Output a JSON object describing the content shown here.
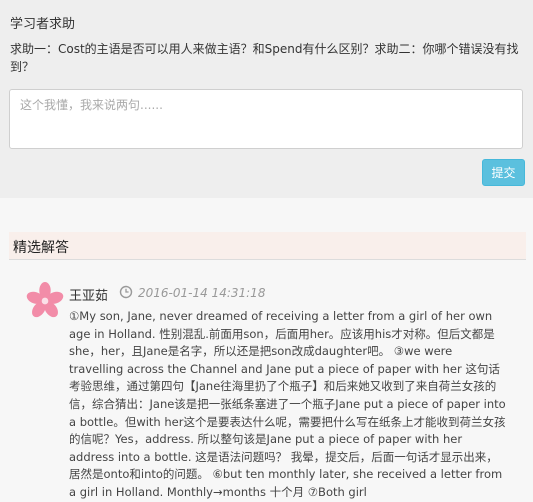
{
  "header": {
    "title": "学习者求助"
  },
  "question": {
    "text": "求助一：Cost的主语是否可以用人来做主语？和Spend有什么区别？求助二：你哪个错误没有找到？"
  },
  "answer_input": {
    "placeholder": "这个我懂，我来说两句......"
  },
  "submit": {
    "label": "提交"
  },
  "section": {
    "title": "精选解答"
  },
  "answer": {
    "author": "王亚茹",
    "time": "2016-01-14 14:31:18",
    "content": "①My son, Jane, never dreamed of receiving a letter from a girl of her own age in Holland. 性别混乱.前面用son，后面用her。应该用his才对称。但后文都是she，her，且Jane是名字，所以还是把son改成daughter吧。 ③we were travelling across the Channel and Jane put a piece of paper with her 这句话考验思维，通过第四句【Jane往海里扔了个瓶子】和后来她又收到了来自荷兰女孩的信，综合猜出：Jane该是把一张纸条塞进了一个瓶子Jane put a piece of paper into a bottle。但with her这个是要表达什么呢，需要把什么写在纸条上才能收到荷兰女孩的信呢？Yes，address. 所以整句该是Jane put a piece of paper with her address into a bottle. 这是语法问题吗？ 我晕，提交后，后面一句话才显示出来，居然是onto和into的问题。 ⑥but ten monthly later, she received a letter from a girl in Holland. Monthly→months 十个月 ⑦Both girl"
  },
  "colors": {
    "top_bg": "#eeeeee",
    "accent": "#5bc0de",
    "section_bg": "#f9efeb"
  },
  "icons": {
    "avatar": "flower-avatar-icon",
    "time": "clock-icon"
  }
}
